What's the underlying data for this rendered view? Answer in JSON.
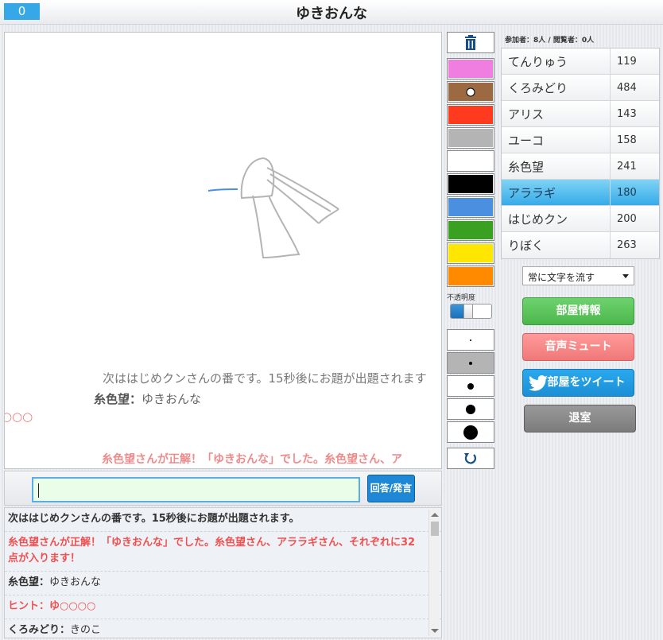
{
  "header": {
    "counter": "0",
    "title": "ゆきおんな"
  },
  "canvas_overlay": {
    "flow_1": "次ははじめクンさんの番です。15秒後にお題が出題されます",
    "flow_2_user": "糸色望",
    "flow_2_sep": "：",
    "flow_2_text": "ゆきおんな",
    "flow_3": "○○○",
    "flow_4": "糸色望さんが正解！「ゆきおんな」でした。糸色望さん、ア"
  },
  "input": {
    "value": "",
    "submit_label": "回答/発言"
  },
  "chat": [
    {
      "type": "sys",
      "text": "次ははじめクンさんの番です。15秒後にお題が出題されます。"
    },
    {
      "type": "red",
      "text": "糸色望さんが正解！「ゆきおんな」でした。糸色望さん、アララギさん、それぞれに32点が入ります！"
    },
    {
      "type": "user",
      "user": "糸色望",
      "sep": "：",
      "text": "ゆきおんな"
    },
    {
      "type": "red",
      "text": "ヒント：ゆ○○○○"
    },
    {
      "type": "user",
      "user": "くろみどり",
      "sep": "：",
      "text": "きのこ"
    }
  ],
  "tools": {
    "trash_icon": "trash-icon",
    "colors": [
      "#ef7ee0",
      "#9c6a42",
      "#ff3a1f",
      "#b4b4b4",
      "#ffffff",
      "#000000",
      "#4a8fe0",
      "#3aa022",
      "#ffe600",
      "#ff8a00"
    ],
    "opacity_label": "不透明度",
    "opacity_value": 0.4,
    "brush_sizes": [
      2,
      4,
      8,
      12,
      18
    ],
    "undo_icon": "undo-icon"
  },
  "sidebar": {
    "participants_label": "参加者：8人 / 閲覧者：0人",
    "players": [
      {
        "name": "てんりゅう",
        "score": "119"
      },
      {
        "name": "くろみどり",
        "score": "484"
      },
      {
        "name": "アリス",
        "score": "143"
      },
      {
        "name": "ユーコ",
        "score": "158"
      },
      {
        "name": "糸色望",
        "score": "241"
      },
      {
        "name": "アララギ",
        "score": "180",
        "active": true
      },
      {
        "name": "はじめクン",
        "score": "200"
      },
      {
        "name": "りぼく",
        "score": "263"
      }
    ],
    "flow_select": "常に文字を流す",
    "room_info": "部屋情報",
    "mute": "音声ミュート",
    "tweet": "部屋をツイート",
    "exit": "退室"
  },
  "colors": {
    "accent": "#36a8e8",
    "active_row": "#36abe8",
    "room_button": "#4bb84b",
    "mute_button": "#f07878",
    "tweet_button": "#1b8fd6",
    "exit_button": "#7c7c7c"
  }
}
